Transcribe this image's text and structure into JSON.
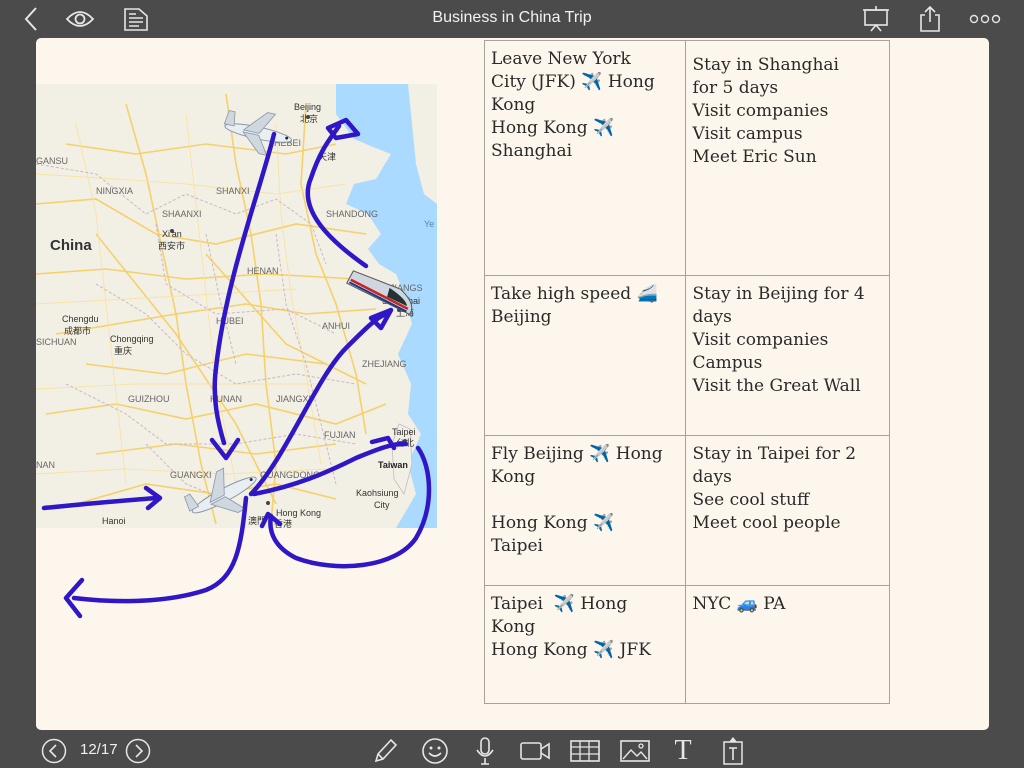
{
  "header": {
    "title": "Business in China Trip",
    "back_icon": "chevron-left-icon",
    "view_icon": "eye-icon",
    "pages_icon": "document-list-icon",
    "present_icon": "presentation-icon",
    "share_icon": "share-icon",
    "more_icon": "more-dots-icon"
  },
  "map": {
    "labels": {
      "beijing": "Beijing",
      "beijing_cn": "北京",
      "tianjin_cn": "天津",
      "hebei": "HEBEI",
      "gansu": "GANSU",
      "ningxia": "NINGXIA",
      "shanxi": "SHANXI",
      "shaanxi": "SHAANXI",
      "shandong": "SHANDONG",
      "china": "China",
      "xian": "Xi'an",
      "xian_cn": "西安市",
      "henan": "HENAN",
      "jiangsu": "JIANGS",
      "shanghai": "Shanghai",
      "shanghai_cn": "上海",
      "chengdu": "Chengdu",
      "chengdu_cn": "成都市",
      "chongqing": "Chongqing",
      "chongqing_cn": "重庆",
      "sichuan": "SICHUAN",
      "hubei": "HUBEI",
      "anhui": "ANHUI",
      "zhejiang": "ZHEJIANG",
      "guizhou": "GUIZHOU",
      "hunan": "HUNAN",
      "jiangxi": "JIANGXI",
      "fujian": "FUJIAN",
      "taipei": "Taipei",
      "taipei_cn": "台北",
      "taiwan": "Taiwan",
      "guangxi": "GUANGXI",
      "guangdong": "GUANGDONG",
      "nan": "NAN",
      "kaohsiung": "Kaohsiung",
      "city": "City",
      "hanoi": "Hanoi",
      "macao": "澳門",
      "hongkong": "Hong Kong",
      "hongkong_cn": "香港",
      "ye": "Ye"
    },
    "colors": {
      "land": "#f2efe4",
      "water": "#aadaff",
      "road": "#f6cf65",
      "border": "#c9b7c6",
      "ink": "#2f16c6"
    }
  },
  "table": {
    "rows": [
      {
        "left": [
          "Leave New York",
          "City (JFK) ✈️ Hong",
          "Kong",
          "Hong Kong ✈️",
          "Shanghai"
        ],
        "right": [
          "Stay in Shanghai",
          "for 5 days",
          "Visit companies",
          "Visit campus",
          "Meet Eric Sun"
        ]
      },
      {
        "left": [
          "Take high speed 🚄",
          "Beijing"
        ],
        "right": [
          "Stay in Beijing for 4",
          "days",
          "Visit companies",
          "Campus",
          "Visit the Great Wall"
        ]
      },
      {
        "left": [
          "Fly Beijing ✈️ Hong",
          "Kong",
          "",
          "Hong Kong ✈️",
          "Taipei"
        ],
        "right": [
          "Stay in Taipei for 2",
          "days",
          "See cool stuff",
          "Meet cool people"
        ]
      },
      {
        "left": [
          "Taipei  ✈️ Hong",
          "Kong",
          "Hong Kong ✈️ JFK"
        ],
        "right": [
          "NYC 🚙 PA"
        ]
      }
    ]
  },
  "footer": {
    "page_indicator": "12/17",
    "prev_icon": "circle-chevron-left-icon",
    "next_icon": "circle-chevron-right-icon",
    "tools": [
      "pencil-icon",
      "emoji-icon",
      "microphone-icon",
      "video-camera-icon",
      "table-icon",
      "image-icon",
      "text-icon",
      "text-box-icon"
    ],
    "text_tool_label": "T"
  }
}
